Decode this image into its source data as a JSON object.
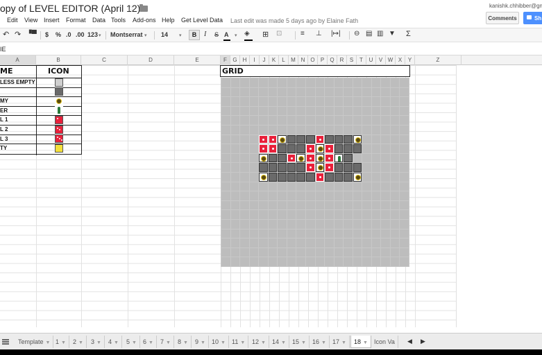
{
  "title_bar": {
    "doc_title": "opy of LEVEL EDITOR (April 12)",
    "user_email": "kanishk.chhibber@gma"
  },
  "menu": {
    "items": [
      "Edit",
      "View",
      "Insert",
      "Format",
      "Data",
      "Tools",
      "Add-ons",
      "Help",
      "Get Level Data"
    ],
    "last_edit": "Last edit was made 5 days ago by Elaine Fath",
    "comments_label": "Comments",
    "share_label": "Sh"
  },
  "toolbar": {
    "currency": "$",
    "percent": "%",
    "decimal_less": ".0",
    "decimal_more": ".00",
    "number_format": "123",
    "font_name": "Montserrat",
    "font_size": "14",
    "bold": "B",
    "italic": "I",
    "strike": "S",
    "text_color": "A"
  },
  "formula_bar": {
    "value": "IE"
  },
  "columns": [
    "A",
    "B",
    "C",
    "D",
    "E",
    "F",
    "G",
    "H",
    "I",
    "J",
    "K",
    "L",
    "M",
    "N",
    "O",
    "P",
    "Q",
    "R",
    "S",
    "T",
    "U",
    "V",
    "W",
    "X",
    "Y",
    "Z"
  ],
  "name_table": {
    "header_name": "ME",
    "header_icon": "ICON",
    "rows": [
      {
        "name": "LESS EMPTY",
        "icon": "light-gray"
      },
      {
        "name": "",
        "icon": "dark-gray"
      },
      {
        "name": "MY",
        "icon": "bug"
      },
      {
        "name": "ER",
        "icon": "player"
      },
      {
        "name": "L 1",
        "icon": "red-1"
      },
      {
        "name": "L 2",
        "icon": "red-2"
      },
      {
        "name": "L 3",
        "icon": "red-3"
      },
      {
        "name": "TY",
        "icon": "yellow"
      }
    ]
  },
  "grid": {
    "header": "GRID",
    "rows": [
      "....................",
      "....................",
      "....................",
      "....................",
      "....................",
      "....................",
      "....RRBWWWRWWWB.....",
      "....RRWWWRBRWWW.....",
      "....BWWRBRBRPW......",
      "....WWWWWRBRWWW.....",
      "....BWWWWWRWWWB.....",
      "....................",
      "....................",
      "....................",
      "....................",
      "....................",
      "....................",
      "....................",
      "....................",
      "...................."
    ]
  },
  "sheet_tabs": {
    "tabs": [
      "Template",
      "1",
      "2",
      "3",
      "4",
      "5",
      "6",
      "7",
      "8",
      "9",
      "10",
      "11",
      "12",
      "14",
      "15",
      "16",
      "17",
      "18",
      "Icon Va"
    ],
    "active": "18"
  },
  "colors": {
    "accent": "#4d90fe",
    "red_block": "#e8203a",
    "wall": "#6a6a6a",
    "yellow": "#f4e03a"
  }
}
